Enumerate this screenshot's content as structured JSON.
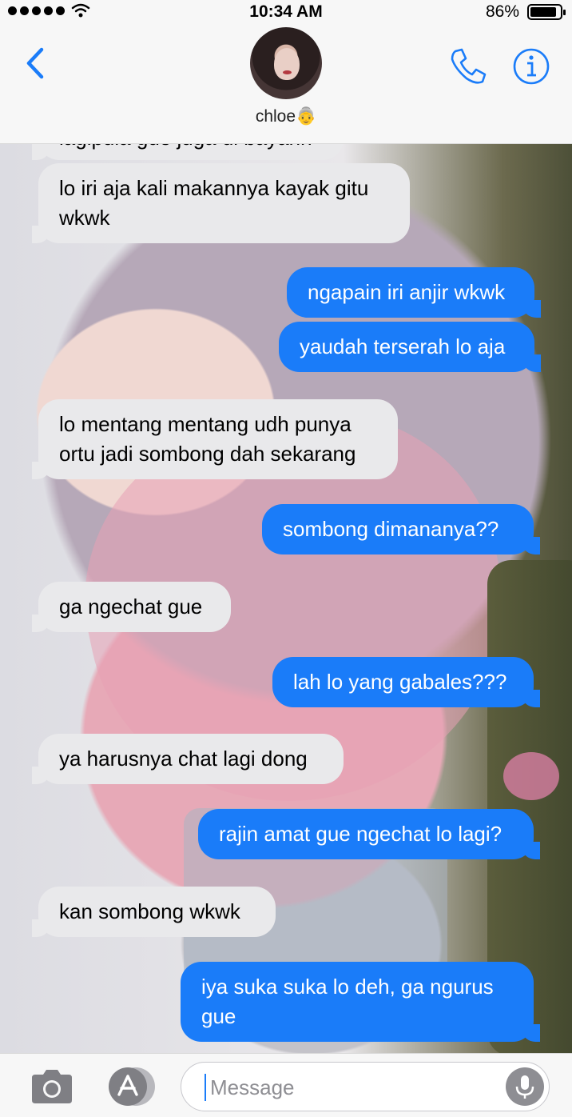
{
  "status_bar": {
    "time": "10:34 AM",
    "battery": "86%",
    "battery_level": 0.86,
    "signal_icon": "signal-dots-icon",
    "wifi_icon": "wifi-icon"
  },
  "header": {
    "contact_name": "chloe👵",
    "back_icon": "chevron-left-icon",
    "phone_icon": "phone-icon",
    "info_icon": "info-icon"
  },
  "messages": [
    {
      "direction": "incoming",
      "text": "lagipula gue juga di bayarin"
    },
    {
      "direction": "incoming",
      "text": "lo iri aja kali makannya kayak gitu wkwk"
    },
    {
      "direction": "outgoing",
      "text": "ngapain iri anjir wkwk"
    },
    {
      "direction": "outgoing",
      "text": "yaudah terserah lo aja"
    },
    {
      "direction": "incoming",
      "text": "lo mentang mentang udh punya ortu jadi sombong dah sekarang"
    },
    {
      "direction": "outgoing",
      "text": "sombong dimananya??"
    },
    {
      "direction": "incoming",
      "text": "ga ngechat gue"
    },
    {
      "direction": "outgoing",
      "text": "lah lo yang gabales???"
    },
    {
      "direction": "incoming",
      "text": "ya harusnya chat lagi dong"
    },
    {
      "direction": "outgoing",
      "text": "rajin amat gue ngechat lo lagi?"
    },
    {
      "direction": "incoming",
      "text": "kan sombong wkwk"
    },
    {
      "direction": "outgoing",
      "text": "iya suka suka lo deh, ga ngurus gue"
    }
  ],
  "input_bar": {
    "placeholder": "Message",
    "value": "",
    "camera_icon": "camera-icon",
    "appstore_icon": "app-store-icon",
    "mic_icon": "microphone-icon"
  },
  "colors": {
    "accent": "#1a7cf9",
    "incoming_bubble": "#e9e9eb",
    "outgoing_bubble": "#1a7cf9"
  }
}
